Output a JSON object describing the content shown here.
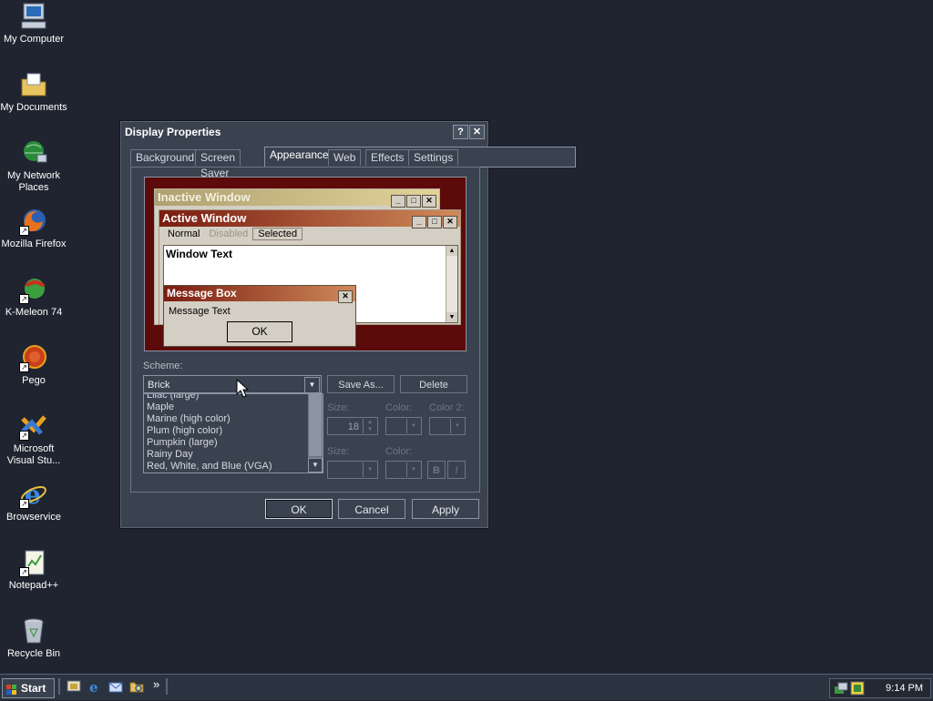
{
  "desktop": {
    "icons": [
      {
        "label": "My Computer"
      },
      {
        "label": "My Documents"
      },
      {
        "label": "My Network Places"
      },
      {
        "label": "Mozilla Firefox"
      },
      {
        "label": "K-Meleon 74"
      },
      {
        "label": "Pego"
      },
      {
        "label": "Microsoft Visual Stu..."
      },
      {
        "label": "Browservice"
      },
      {
        "label": "Notepad++"
      },
      {
        "label": "Recycle Bin"
      }
    ]
  },
  "dialog": {
    "title": "Display Properties",
    "help_btn": "?",
    "close_btn": "✕",
    "tabs": [
      "Background",
      "Screen Saver",
      "Appearance",
      "Web",
      "Effects",
      "Settings"
    ],
    "active_tab": "Appearance",
    "preview": {
      "inactive_title": "Inactive Window",
      "active_title": "Active Window",
      "menu": [
        "Normal",
        "Disabled",
        "Selected"
      ],
      "window_text": "Window Text",
      "msgbox_title": "Message Box",
      "msgbox_text": "Message Text",
      "msgbox_ok": "OK"
    },
    "scheme_label": "Scheme:",
    "scheme_value": "Brick",
    "scheme_list": [
      "Lilac (large)",
      "Maple",
      "Marine (high color)",
      "Plum (high color)",
      "Pumpkin (large)",
      "Rainy Day",
      "Red, White, and Blue (VGA)"
    ],
    "save_as": "Save As...",
    "delete": "Delete",
    "size_label": "Size:",
    "color_label": "Color:",
    "color2_label": "Color 2:",
    "size_value": "18",
    "size2_label": "Size:",
    "color3_label": "Color:",
    "bold_btn": "B",
    "italic_btn": "I",
    "ok": "OK",
    "cancel": "Cancel",
    "apply": "Apply"
  },
  "taskbar": {
    "start": "Start",
    "chevron": "»",
    "clock": "9:14 PM"
  },
  "colors": {
    "desktop_bg": "#1f2430",
    "window_bg": "#3a4250",
    "preview_bg": "#5c0a0a",
    "active_caption": "#7a1c10",
    "inactive_caption": "#b0a070"
  }
}
